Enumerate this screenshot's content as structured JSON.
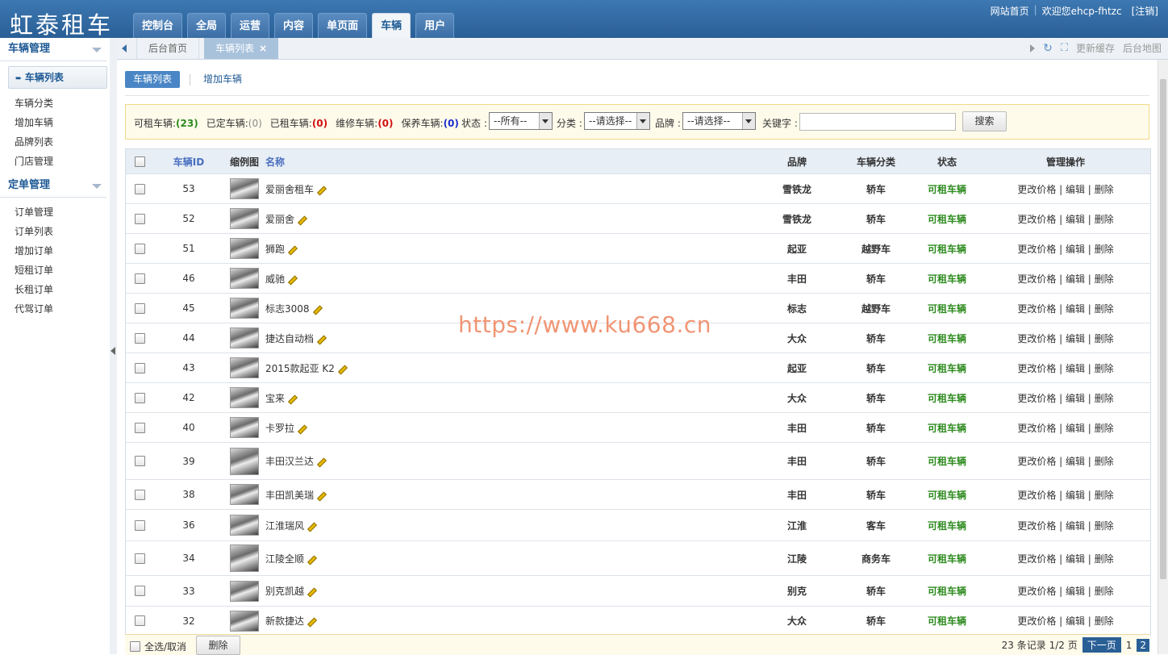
{
  "app": {
    "logo": "虹泰租车",
    "nav": [
      "控制台",
      "全局",
      "运营",
      "内容",
      "单页面",
      "车辆",
      "用户"
    ],
    "nav_active_index": 5,
    "toplinks": {
      "site_home": "网站首页",
      "welcome": "欢迎您ehcp-fhtzc",
      "logout": "[注销]"
    }
  },
  "sidebar": {
    "sections": [
      {
        "title": "车辆管理",
        "items": [
          "车辆列表",
          "车辆分类",
          "增加车辆",
          "品牌列表",
          "门店管理"
        ]
      },
      {
        "title": "定单管理",
        "items": [
          "订单管理",
          "订单列表",
          "增加订单",
          "短租订单",
          "长租订单",
          "代驾订单"
        ]
      }
    ],
    "active_item": "车辆列表"
  },
  "tabs": {
    "home": "后台首页",
    "current": "车辆列表",
    "close": "×",
    "refresh_cache": "更新缓存",
    "sitemap": "后台地图"
  },
  "subtabs": {
    "list": "车辆列表",
    "add": "增加车辆"
  },
  "filter": {
    "counts": [
      {
        "label": "可租车辆:",
        "value": "(23)"
      },
      {
        "label": "已定车辆:",
        "value": "(0)"
      },
      {
        "label": "已租车辆:",
        "value": "(0)"
      },
      {
        "label": "维修车辆:",
        "value": "(0)"
      },
      {
        "label": "保养车辆:",
        "value": "(0)"
      }
    ],
    "status_label": "状态 :",
    "status_value": "--所有--",
    "category_label": "分类 :",
    "category_value": "--请选择--",
    "brand_label": "品牌 :",
    "brand_value": "--请选择--",
    "keyword_label": "关键字 :",
    "keyword_value": "",
    "search_button": "搜索"
  },
  "table": {
    "headers": {
      "id": "车辆ID",
      "thumb": "缩例图",
      "name": "名称",
      "brand": "品牌",
      "category": "车辆分类",
      "status": "状态",
      "ops": "管理操作"
    },
    "ops_text": "更改价格 | 编辑 | 删除",
    "rows": [
      {
        "id": "53",
        "name": "爱丽舍租车",
        "brand": "雪铁龙",
        "category": "轿车",
        "status": "可租车辆"
      },
      {
        "id": "52",
        "name": "爱丽舍",
        "brand": "雪铁龙",
        "category": "轿车",
        "status": "可租车辆"
      },
      {
        "id": "51",
        "name": "狮跑",
        "brand": "起亚",
        "category": "越野车",
        "status": "可租车辆"
      },
      {
        "id": "46",
        "name": "威驰",
        "brand": "丰田",
        "category": "轿车",
        "status": "可租车辆"
      },
      {
        "id": "45",
        "name": "标志3008",
        "brand": "标志",
        "category": "越野车",
        "status": "可租车辆"
      },
      {
        "id": "44",
        "name": "捷达自动档",
        "brand": "大众",
        "category": "轿车",
        "status": "可租车辆"
      },
      {
        "id": "43",
        "name": "2015款起亚 K2",
        "brand": "起亚",
        "category": "轿车",
        "status": "可租车辆"
      },
      {
        "id": "42",
        "name": "宝来",
        "brand": "大众",
        "category": "轿车",
        "status": "可租车辆"
      },
      {
        "id": "40",
        "name": "卡罗拉",
        "brand": "丰田",
        "category": "轿车",
        "status": "可租车辆"
      },
      {
        "id": "39",
        "name": "丰田汉兰达",
        "brand": "丰田",
        "category": "轿车",
        "status": "可租车辆"
      },
      {
        "id": "38",
        "name": "丰田凯美瑞",
        "brand": "丰田",
        "category": "轿车",
        "status": "可租车辆"
      },
      {
        "id": "36",
        "name": "江淮瑞风",
        "brand": "江淮",
        "category": "客车",
        "status": "可租车辆"
      },
      {
        "id": "34",
        "name": "江陵全顺",
        "brand": "江陵",
        "category": "商务车",
        "status": "可租车辆"
      },
      {
        "id": "33",
        "name": "别克凯越",
        "brand": "别克",
        "category": "轿车",
        "status": "可租车辆"
      },
      {
        "id": "32",
        "name": "新款捷达",
        "brand": "大众",
        "category": "轿车",
        "status": "可租车辆"
      }
    ]
  },
  "footer": {
    "select_all": "全选/取消",
    "delete_button": "删除",
    "records": "23 条记录 1/2 页",
    "next": "下一页",
    "pages": [
      "1",
      "2"
    ],
    "current_page": "2"
  },
  "watermark": "https://www.ku668.cn"
}
